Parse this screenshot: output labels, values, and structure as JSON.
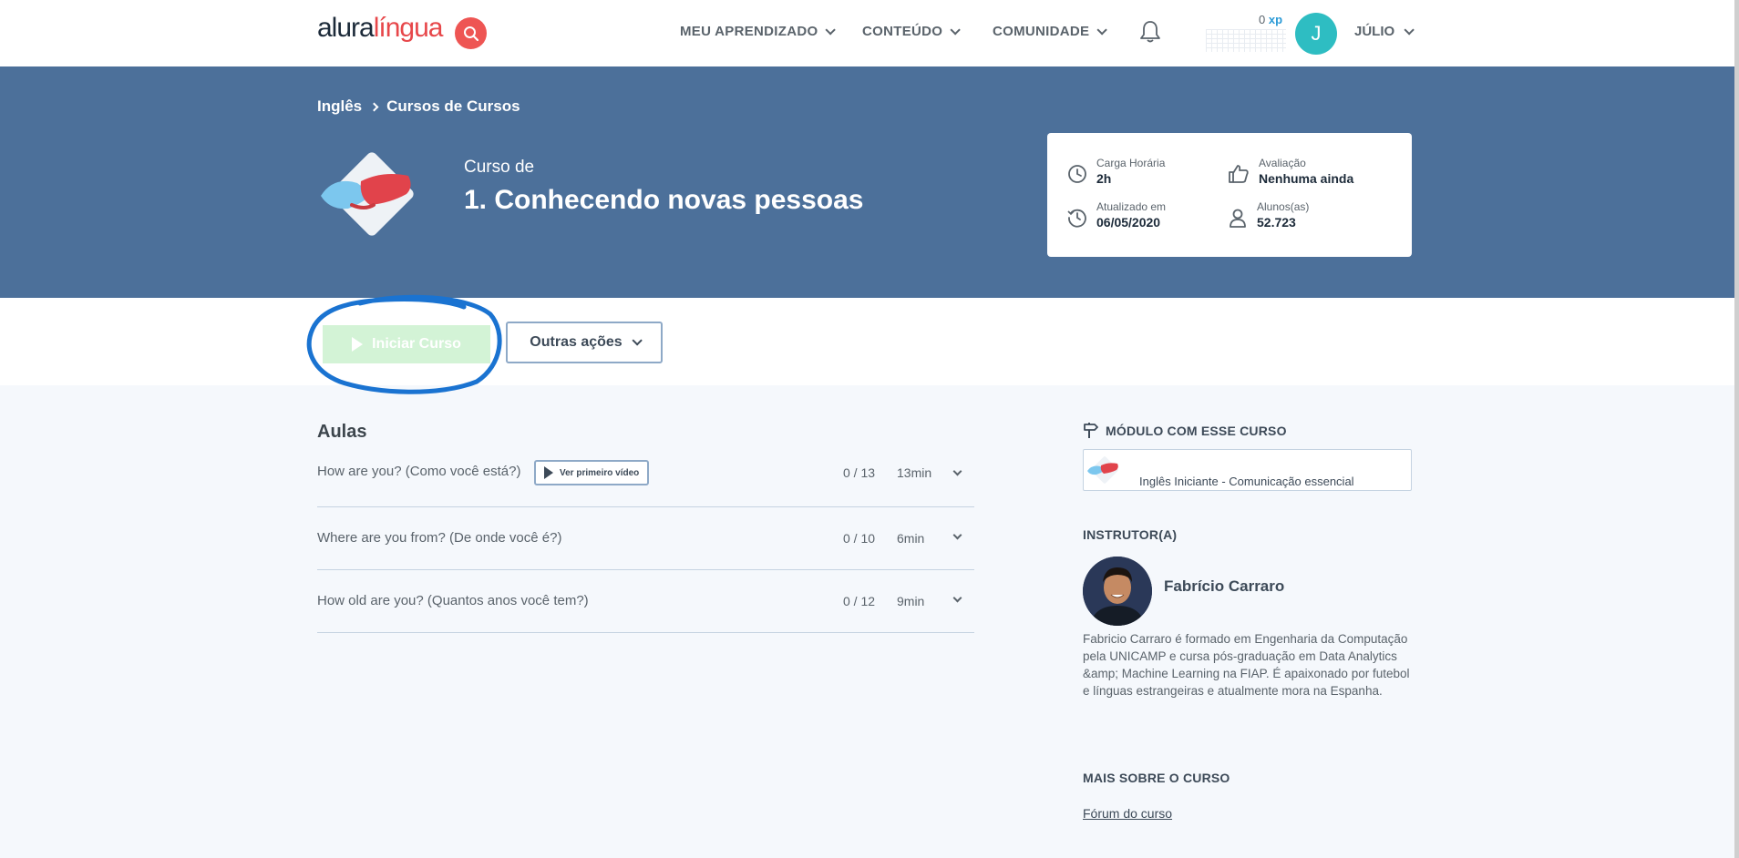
{
  "header": {
    "logo_part1": "alura",
    "logo_part2": "língua",
    "nav": [
      "MEU APRENDIZADO",
      "CONTEÚDO",
      "COMUNIDADE"
    ],
    "xp_value": "0",
    "xp_unit": "xp",
    "avatar_initial": "J",
    "user_name": "JÚLIO"
  },
  "breadcrumb": [
    "Inglês",
    "Cursos de Cursos"
  ],
  "course": {
    "kicker": "Curso de",
    "title": "1. Conhecendo novas pessoas"
  },
  "info": {
    "workload_label": "Carga Horária",
    "workload_value": "2h",
    "rating_label": "Avaliação",
    "rating_value": "Nenhuma ainda",
    "updated_label": "Atualizado em",
    "updated_value": "06/05/2020",
    "students_label": "Alunos(as)",
    "students_value": "52.723"
  },
  "actions": {
    "start_label": "Iniciar Curso",
    "other_label": "Outras ações"
  },
  "lessons": {
    "title": "Aulas",
    "first_video_label": "Ver primeiro vídeo",
    "items": [
      {
        "name": "How are you? (Como você está?)",
        "progress": "0 / 13",
        "duration": "13min"
      },
      {
        "name": "Where are you from? (De onde você é?)",
        "progress": "0 / 10",
        "duration": "6min"
      },
      {
        "name": "How old are you? (Quantos anos você tem?)",
        "progress": "0 / 12",
        "duration": "9min"
      }
    ]
  },
  "sidebar": {
    "module_heading": "MÓDULO COM ESSE CURSO",
    "module_name": "Inglês Iniciante - Comunicação essencial",
    "instructor_heading": "INSTRUTOR(A)",
    "instructor_name": "Fabrício Carraro",
    "instructor_bio": "Fabricio Carraro é formado em Engenharia da Computação pela UNICAMP e cursa pós-graduação em Data Analytics &amp; Machine Learning na FIAP. É apaixonado por futebol e línguas estrangeiras e atualmente mora na Espanha.",
    "more_heading": "MAIS SOBRE O CURSO",
    "forum_link": "Fórum do curso"
  },
  "colors": {
    "hero_bg": "#4c709a",
    "accent_red": "#ee5553",
    "start_button": "#d3f3d6",
    "annotation_circle": "#1a73d1"
  }
}
